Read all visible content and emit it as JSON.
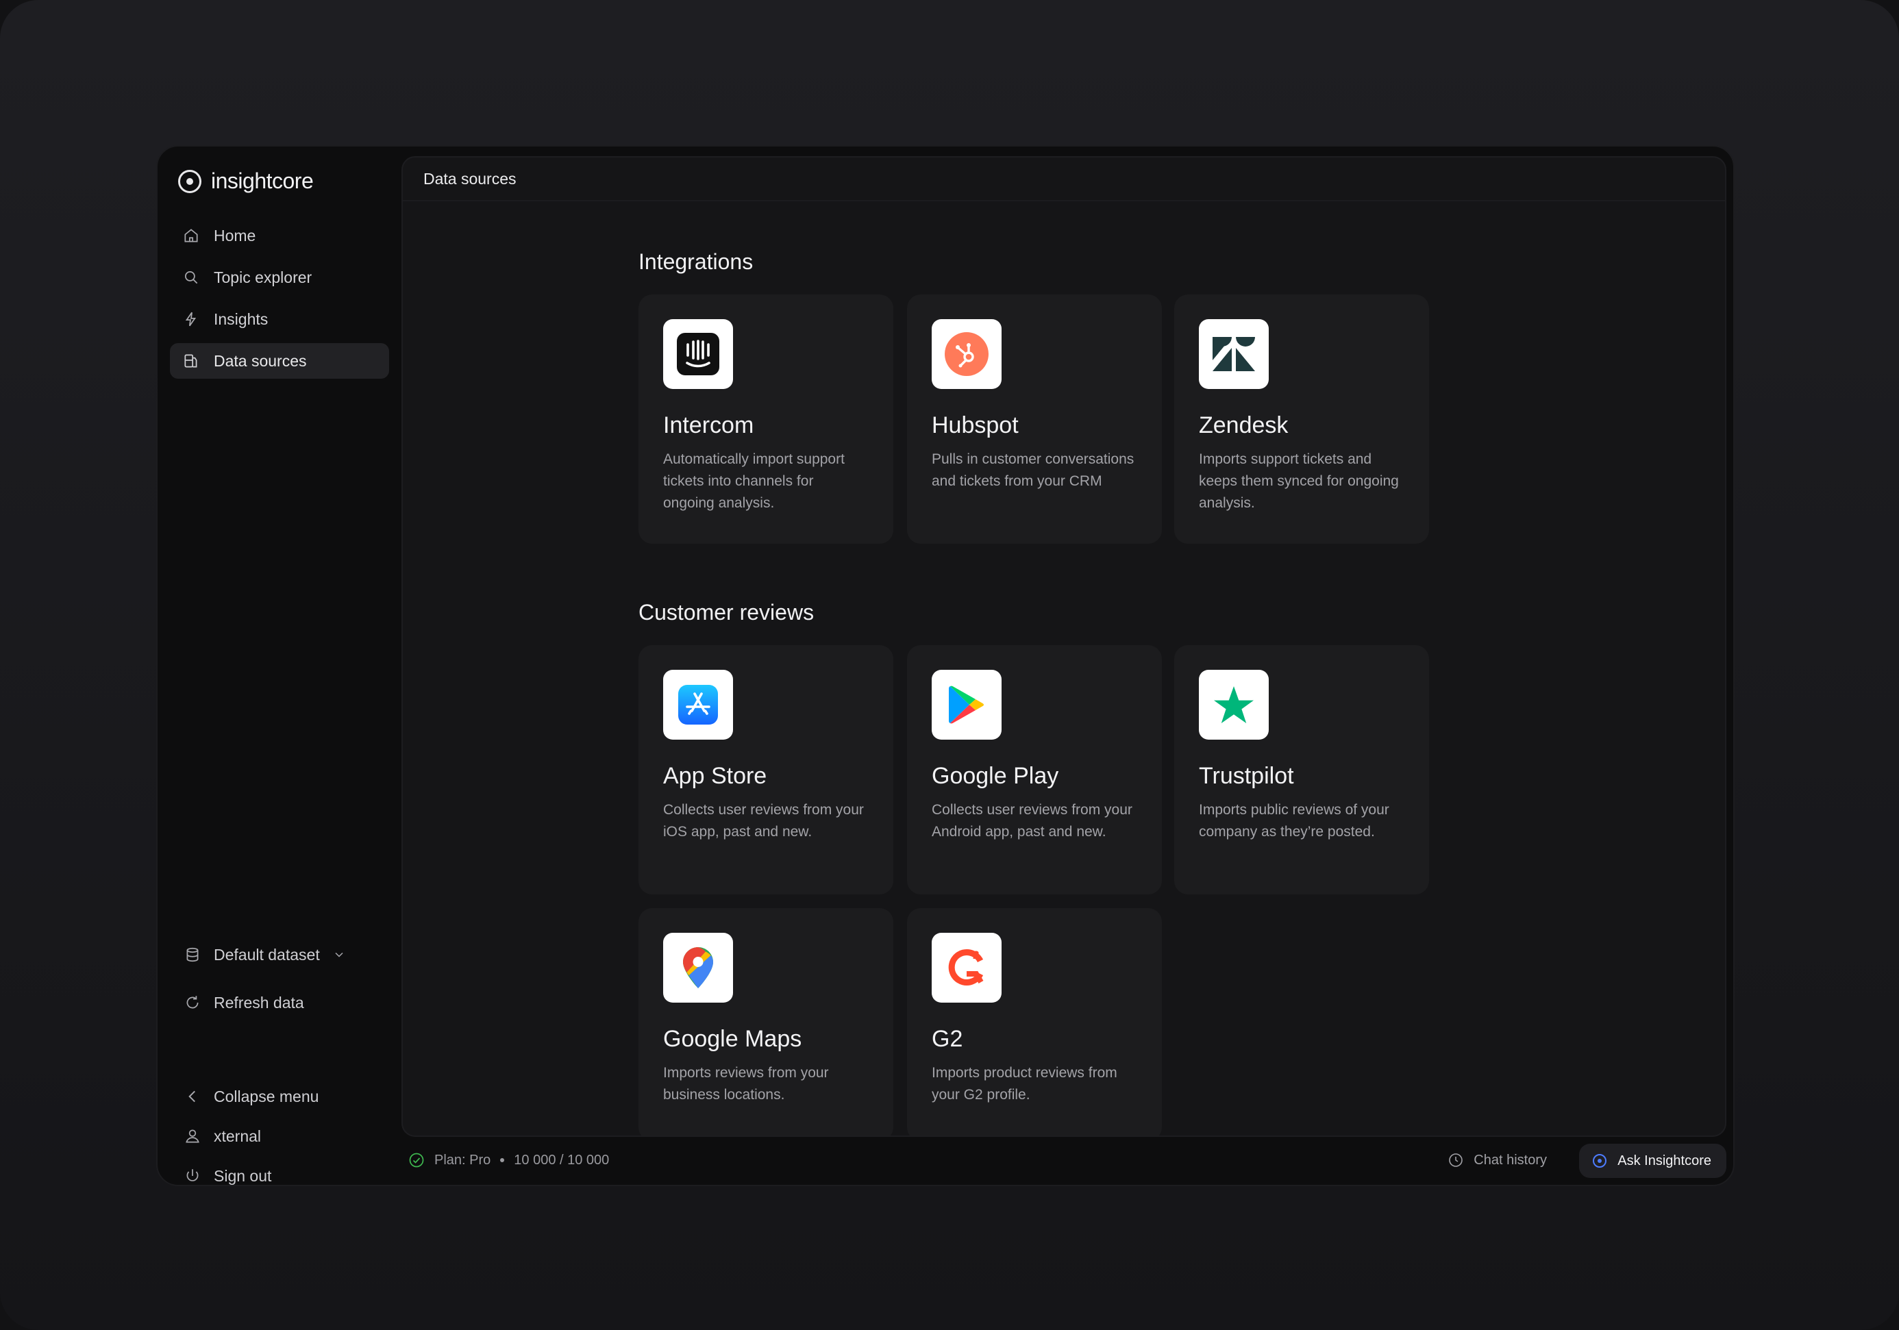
{
  "app": {
    "name": "insightcore"
  },
  "sidebar": {
    "items": [
      {
        "label": "Home",
        "icon": "home-icon"
      },
      {
        "label": "Topic explorer",
        "icon": "search-icon"
      },
      {
        "label": "Insights",
        "icon": "lightning-icon"
      },
      {
        "label": "Data sources",
        "icon": "data-sources-icon",
        "active": true
      }
    ],
    "dataset": {
      "label": "Default dataset"
    },
    "refresh": {
      "label": "Refresh data"
    },
    "collapse": {
      "label": "Collapse menu"
    },
    "user": {
      "label": "xternal"
    },
    "signout": {
      "label": "Sign out"
    }
  },
  "header": {
    "title": "Data sources"
  },
  "sections": {
    "integrations": {
      "title": "Integrations",
      "cards": [
        {
          "name": "Intercom",
          "desc": "Automatically import support tickets into channels for ongoing analysis.",
          "icon": "intercom-logo-icon"
        },
        {
          "name": "Hubspot",
          "desc": "Pulls in customer conversations and tickets from your CRM",
          "icon": "hubspot-logo-icon"
        },
        {
          "name": "Zendesk",
          "desc": "Imports support tickets and keeps them synced for ongoing analysis.",
          "icon": "zendesk-logo-icon"
        }
      ]
    },
    "reviews": {
      "title": "Customer reviews",
      "cards": [
        {
          "name": "App Store",
          "desc": "Collects user reviews from your iOS app, past and new.",
          "icon": "app-store-logo-icon"
        },
        {
          "name": "Google Play",
          "desc": "Collects user reviews from your Android app, past and new.",
          "icon": "google-play-logo-icon"
        },
        {
          "name": "Trustpilot",
          "desc": "Imports public reviews of your company as they’re posted.",
          "icon": "trustpilot-logo-icon"
        },
        {
          "name": "Google Maps",
          "desc": "Imports reviews from your business locations.",
          "icon": "google-maps-logo-icon"
        },
        {
          "name": "G2",
          "desc": "Imports product reviews from your G2 profile.",
          "icon": "g2-logo-icon"
        }
      ]
    }
  },
  "status": {
    "plan": "Plan: Pro",
    "usage": "10 000 / 10 000",
    "chat_history": "Chat history",
    "ask": "Ask Insightcore"
  },
  "colors": {
    "background": "#121214",
    "panel": "#151517",
    "card": "#1c1c1e",
    "hubspot": "#ff7a59",
    "trustpilot": "#00b67a",
    "g2": "#ff492c",
    "app_store": "#1e90ff",
    "accent": "#4d7cff"
  }
}
